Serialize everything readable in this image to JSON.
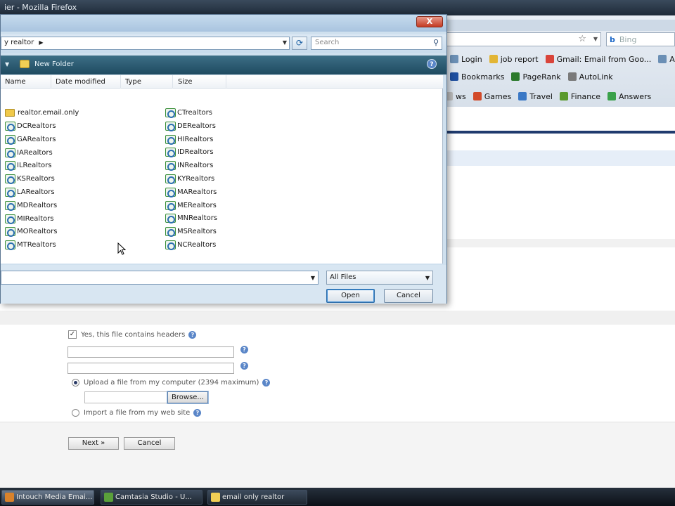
{
  "firefox": {
    "title": "ier - Mozilla Firefox",
    "search_placeholder": "Bing",
    "bookmarks_row1": [
      {
        "label": "Login",
        "color": "#6b8fb5"
      },
      {
        "label": "job report",
        "color": "#e2b535"
      },
      {
        "label": "Gmail: Email from Goo...",
        "color": "#d9443a"
      },
      {
        "label": "Au",
        "color": "#6b8fb5"
      }
    ],
    "bookmarks_row2": [
      {
        "label": "Bookmarks",
        "color": "#1f4fa0"
      },
      {
        "label": "PageRank",
        "color": "#2c7a2c"
      },
      {
        "label": "AutoLink",
        "color": "#7a7a7a"
      }
    ],
    "bookmarks_row3": [
      {
        "label": "ws",
        "color": "#bbbbbb"
      },
      {
        "label": "Games",
        "color": "#d24a2a"
      },
      {
        "label": "Travel",
        "color": "#3a78c6"
      },
      {
        "label": "Finance",
        "color": "#5b9a2e"
      },
      {
        "label": "Answers",
        "color": "#3aa14a"
      }
    ]
  },
  "form": {
    "headers_checkbox_label": "Yes, this file contains headers",
    "upload_label": "Upload a file from my computer (2394 maximum)",
    "browse_label": "Browse...",
    "import_label": "Import a file from my web site",
    "next_label": "Next »",
    "cancel_label": "Cancel"
  },
  "dialog": {
    "address": "y realtor",
    "search_placeholder": "Search",
    "new_folder_label": "New Folder",
    "close_glyph": "X",
    "columns": [
      "Name",
      "Date modified",
      "Type",
      "Size"
    ],
    "folder_item": "realtor.email.only",
    "files_col1": [
      "DCRealtors",
      "GARealtors",
      "IARealtors",
      "ILRealtors",
      "KSRealtors",
      "LARealtors",
      "MDRealtors",
      "MIRealtors",
      "MORealtors",
      "MTRealtors"
    ],
    "files_col2": [
      "CTrealtors",
      "DERealtors",
      "HIRealtors",
      "IDRealtors",
      "INRealtors",
      "KYRealtors",
      "MARealtors",
      "MERealtors",
      "MNRealtors",
      "MSRealtors",
      "NCRealtors"
    ],
    "filename_value": "",
    "filetype_value": "All Files",
    "open_label": "Open",
    "cancel_label": "Cancel"
  },
  "taskbar": {
    "items": [
      {
        "label": "Intouch Media Emai...",
        "icon_color": "#d9822b"
      },
      {
        "label": "Camtasia Studio - U...",
        "icon_color": "#5aa03a"
      },
      {
        "label": "email only realtor",
        "icon_color": "#f1cf55"
      }
    ]
  }
}
